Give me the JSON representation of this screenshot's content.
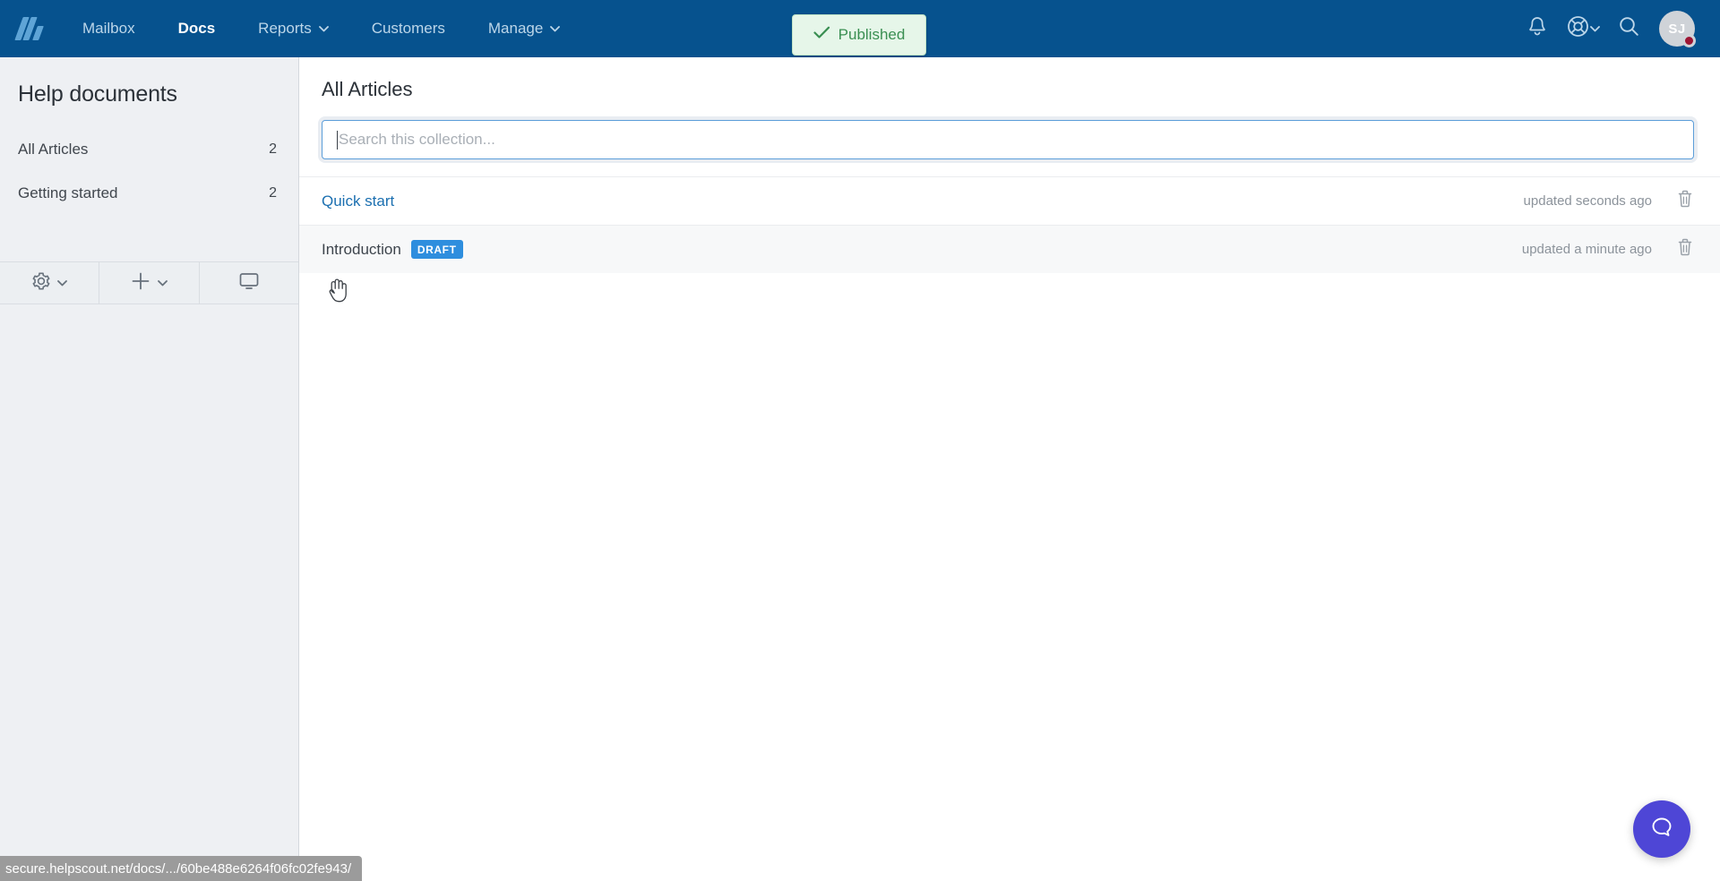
{
  "topnav": {
    "logo_name": "helpscout-logo",
    "items": [
      {
        "label": "Mailbox",
        "active": false,
        "has_chevron": false
      },
      {
        "label": "Docs",
        "active": true,
        "has_chevron": false
      },
      {
        "label": "Reports",
        "active": false,
        "has_chevron": true
      },
      {
        "label": "Customers",
        "active": false,
        "has_chevron": false
      },
      {
        "label": "Manage",
        "active": false,
        "has_chevron": true
      }
    ],
    "right": {
      "notifications_icon": "bell-icon",
      "help_icon": "lifebuoy-icon",
      "help_chevron_icon": "chevron-down-icon",
      "search_icon": "search-icon",
      "avatar_initials": "SJ",
      "avatar_badge": "status-badge"
    },
    "bg_color": "#06528e"
  },
  "toast": {
    "label": "Published",
    "icon": "check-icon",
    "text_color": "#3a8f52",
    "bg_color": "#e6f6e9"
  },
  "sidebar": {
    "title": "Help documents",
    "items": [
      {
        "label": "All Articles",
        "count": "2"
      },
      {
        "label": "Getting started",
        "count": "2"
      }
    ],
    "toolbar": [
      {
        "name": "settings",
        "icon": "gear-icon",
        "chevron": "chevron-down-icon"
      },
      {
        "name": "add",
        "icon": "plus-icon",
        "chevron": "chevron-down-icon"
      },
      {
        "name": "preview",
        "icon": "monitor-icon",
        "chevron": ""
      }
    ]
  },
  "main": {
    "title": "All Articles",
    "search": {
      "placeholder": "Search this collection...",
      "value": ""
    },
    "articles": [
      {
        "title": "Quick start",
        "badge": "",
        "meta": "updated seconds ago",
        "delete_icon": "trash-icon",
        "hovered": false
      },
      {
        "title": "Introduction",
        "badge": "DRAFT",
        "meta": "updated a minute ago",
        "delete_icon": "trash-icon",
        "hovered": true
      }
    ]
  },
  "beacon": {
    "icon": "chat-bubble-icon",
    "color": "#4e46d6"
  },
  "statusbar": {
    "url": "secure.helpscout.net/docs/.../60be488e6264f06fc02fe943/"
  }
}
